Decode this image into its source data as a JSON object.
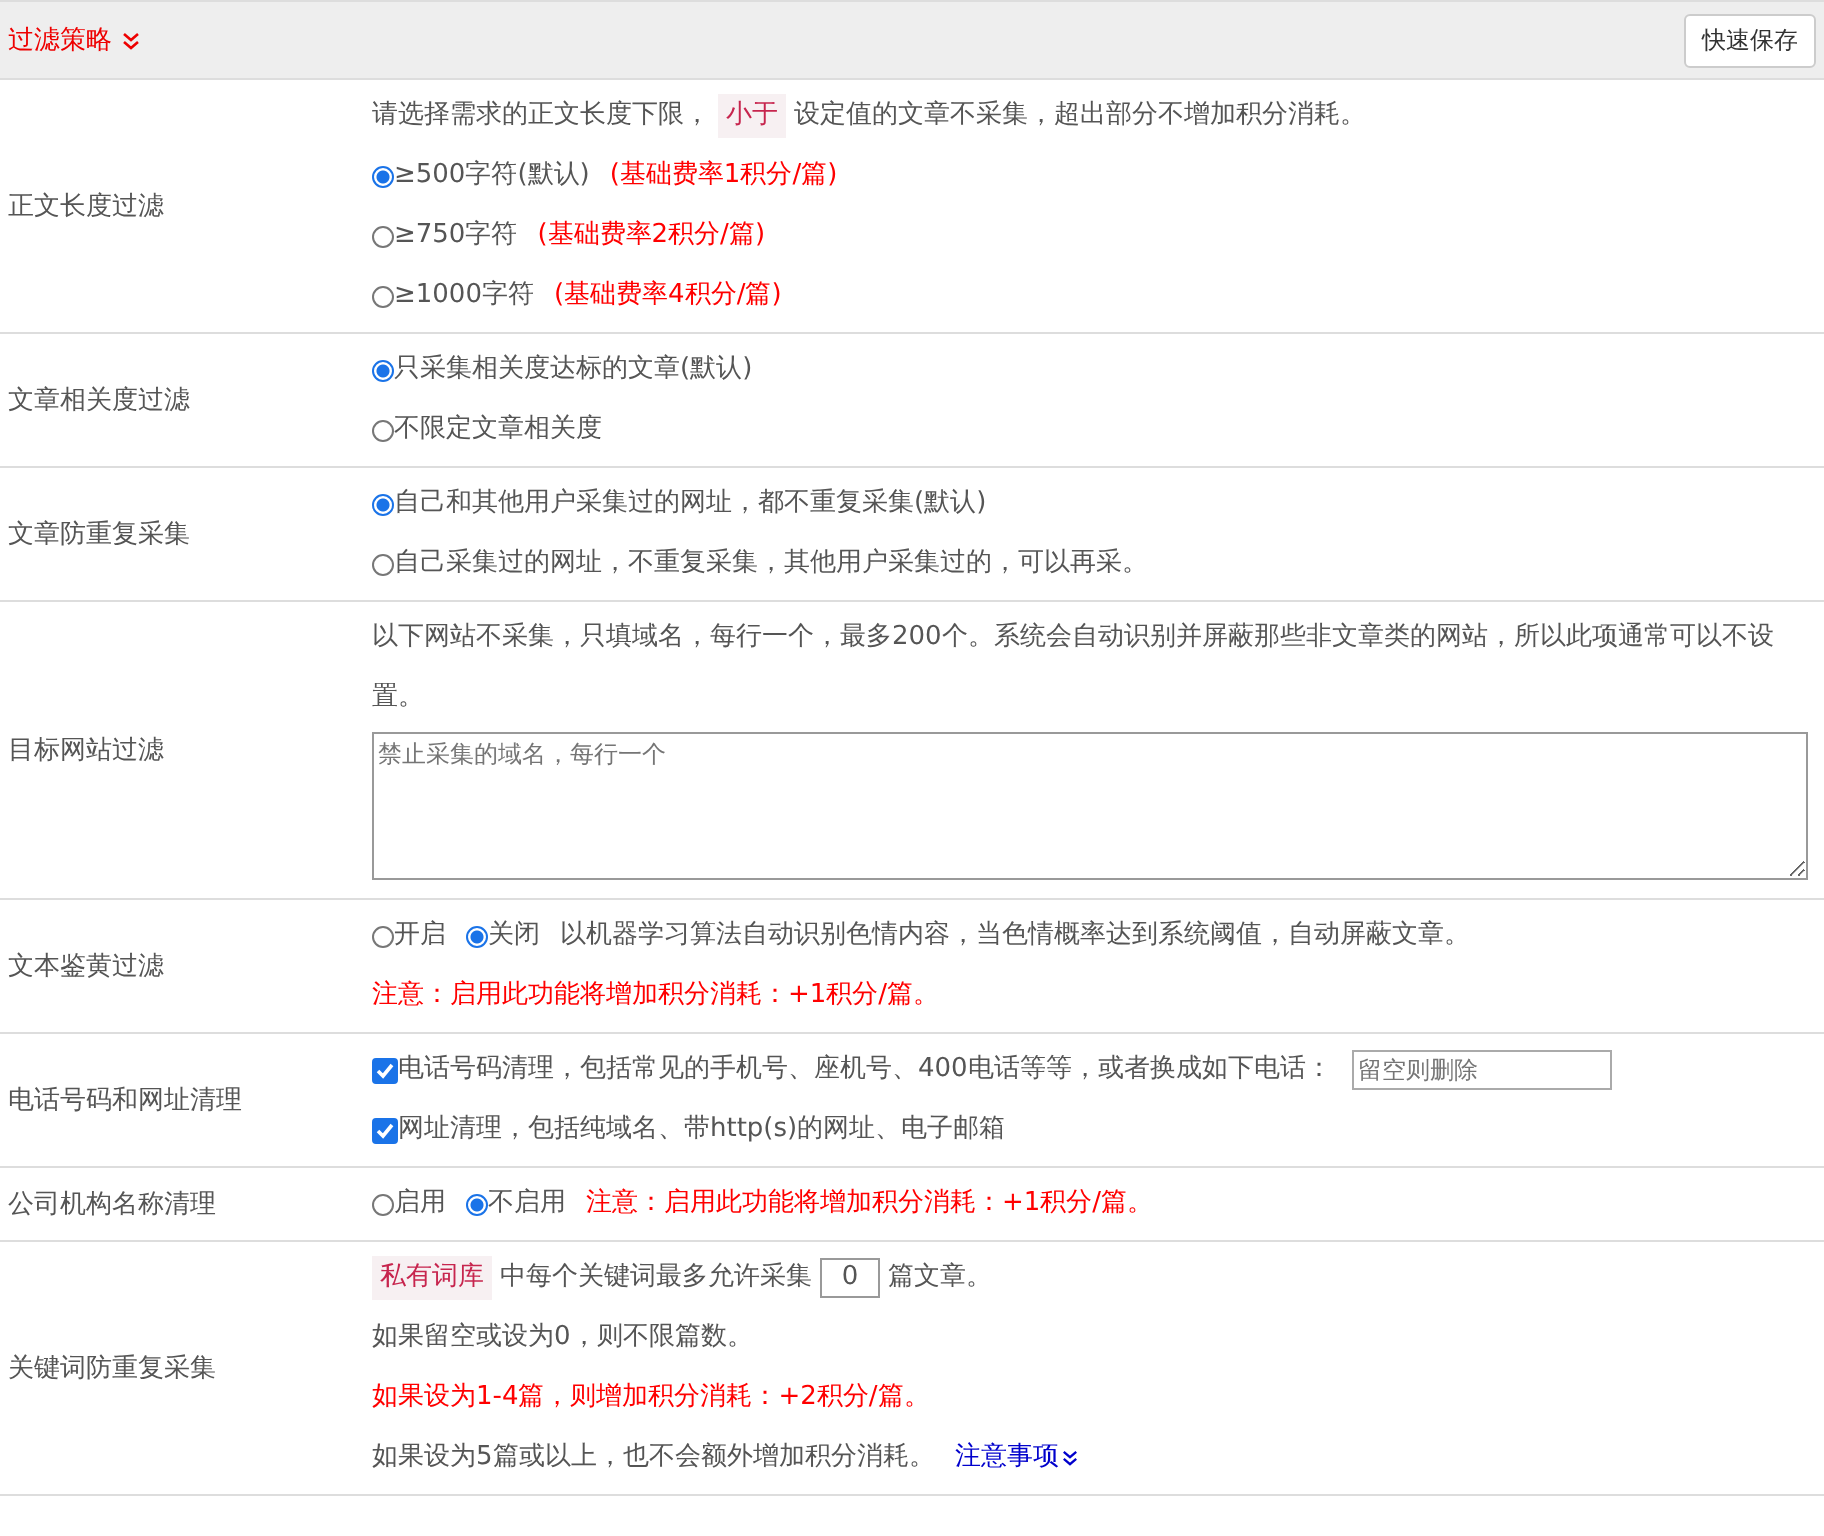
{
  "header": {
    "title": "过滤策略",
    "save_button": "快速保存"
  },
  "rows": [
    {
      "label": "正文长度过滤",
      "lines": [
        {
          "kind": "line",
          "parts": [
            {
              "kind": "plain",
              "text": "请选择需求的正文长度下限，"
            },
            {
              "kind": "tag",
              "text": "小于"
            },
            {
              "kind": "plain",
              "text": "设定值的文章不采集，超出部分不增加积分消耗。"
            }
          ]
        },
        {
          "kind": "line",
          "parts": [
            {
              "kind": "radio",
              "text": "≥500字符(默认)",
              "selected": true
            },
            {
              "kind": "warn",
              "text": "(基础费率1积分/篇)"
            }
          ]
        },
        {
          "kind": "line",
          "parts": [
            {
              "kind": "radio",
              "text": "≥750字符",
              "selected": false
            },
            {
              "kind": "warn",
              "text": "(基础费率2积分/篇)"
            }
          ]
        },
        {
          "kind": "line",
          "parts": [
            {
              "kind": "radio",
              "text": "≥1000字符",
              "selected": false
            },
            {
              "kind": "warn",
              "text": "(基础费率4积分/篇)"
            }
          ]
        }
      ]
    },
    {
      "label": "文章相关度过滤",
      "lines": [
        {
          "kind": "line",
          "parts": [
            {
              "kind": "radio",
              "text": "只采集相关度达标的文章(默认)",
              "selected": true
            }
          ]
        },
        {
          "kind": "line",
          "parts": [
            {
              "kind": "radio",
              "text": "不限定文章相关度",
              "selected": false
            }
          ]
        }
      ]
    },
    {
      "label": "文章防重复采集",
      "lines": [
        {
          "kind": "line",
          "parts": [
            {
              "kind": "radio",
              "text": "自己和其他用户采集过的网址，都不重复采集(默认)",
              "selected": true
            }
          ]
        },
        {
          "kind": "line",
          "parts": [
            {
              "kind": "radio",
              "text": "自己采集过的网址，不重复采集，其他用户采集过的，可以再采。",
              "selected": false
            }
          ]
        }
      ]
    },
    {
      "label": "目标网站过滤",
      "lines": [
        {
          "kind": "line",
          "parts": [
            {
              "kind": "plain",
              "text": "以下网站不采集，只填域名，每行一个，最多200个。系统会自动识别并屏蔽那些非文章类的网站，所以此项通常可以不设置。"
            }
          ]
        },
        {
          "kind": "textarea",
          "placeholder": "禁止采集的域名，每行一个"
        }
      ]
    },
    {
      "label": "文本鉴黄过滤",
      "lines": [
        {
          "kind": "line",
          "parts": [
            {
              "kind": "radio",
              "text": "开启",
              "selected": false
            },
            {
              "kind": "radio",
              "text": "关闭",
              "selected": true
            },
            {
              "kind": "plain",
              "text": "以机器学习算法自动识别色情内容，当色情概率达到系统阈值，自动屏蔽文章。"
            }
          ]
        },
        {
          "kind": "line",
          "parts": [
            {
              "kind": "warn",
              "text": "注意：启用此功能将增加积分消耗：+1积分/篇。"
            }
          ]
        }
      ]
    },
    {
      "label": "电话号码和网址清理",
      "lines": [
        {
          "kind": "line",
          "parts": [
            {
              "kind": "checkbox",
              "text": "电话号码清理，包括常见的手机号、座机号、400电话等等，或者换成如下电话：",
              "checked": true
            },
            {
              "kind": "field",
              "placeholder": "留空则删除"
            }
          ]
        },
        {
          "kind": "line",
          "parts": [
            {
              "kind": "checkbox",
              "text": "网址清理，包括纯域名、带http(s)的网址、电子邮箱",
              "checked": true
            }
          ]
        }
      ]
    },
    {
      "label": "公司机构名称清理",
      "lines": [
        {
          "kind": "line",
          "parts": [
            {
              "kind": "radio",
              "text": "启用",
              "selected": false
            },
            {
              "kind": "radio",
              "text": "不启用",
              "selected": true
            },
            {
              "kind": "warn",
              "text": "注意：启用此功能将增加积分消耗：+1积分/篇。"
            }
          ]
        }
      ]
    },
    {
      "label": "关键词防重复采集",
      "lines": [
        {
          "kind": "line",
          "parts": [
            {
              "kind": "tag",
              "text": "私有词库"
            },
            {
              "kind": "plain",
              "text": "中每个关键词最多允许采集"
            },
            {
              "kind": "input",
              "value": "0"
            },
            {
              "kind": "plain",
              "text": "篇文章。"
            }
          ]
        },
        {
          "kind": "line",
          "parts": [
            {
              "kind": "plain",
              "text": "如果留空或设为0，则不限篇数。"
            }
          ]
        },
        {
          "kind": "line",
          "parts": [
            {
              "kind": "warn",
              "text": "如果设为1-4篇，则增加积分消耗：+2积分/篇。"
            }
          ]
        },
        {
          "kind": "line",
          "parts": [
            {
              "kind": "plain",
              "text": "如果设为5篇或以上，也不会额外增加积分消耗。"
            },
            {
              "kind": "link",
              "text": "注意事项"
            }
          ]
        }
      ]
    }
  ]
}
